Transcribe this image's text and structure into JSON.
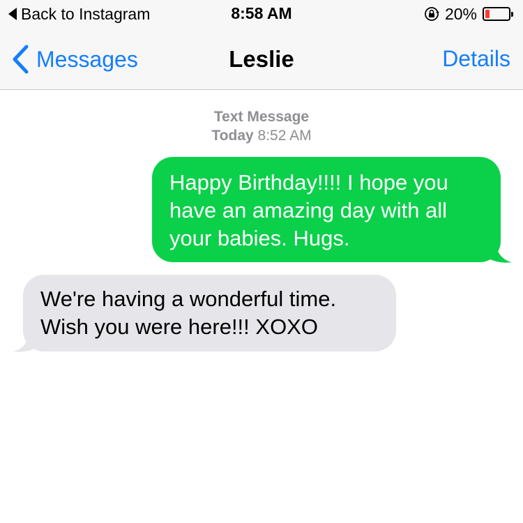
{
  "status_bar": {
    "back_label": "Back to Instagram",
    "time": "8:58 AM",
    "battery_text": "20%",
    "battery_level": 0.2,
    "icons": [
      "back-triangle-icon",
      "rotation-lock-icon",
      "battery-icon"
    ]
  },
  "nav": {
    "back_label": "Messages",
    "title": "Leslie",
    "details_label": "Details",
    "accent_color": "#147efb"
  },
  "thread": {
    "service_label": "Text Message",
    "date_day": "Today",
    "date_time": "8:52 AM",
    "messages": [
      {
        "direction": "sent",
        "text": "Happy Birthday!!!! I hope you have an amazing day with all your babies. Hugs.",
        "color": "#0bd04a"
      },
      {
        "direction": "received",
        "text": "We're having a wonderful time. Wish you were here!!!  XOXO",
        "color": "#e5e5ea"
      }
    ]
  }
}
